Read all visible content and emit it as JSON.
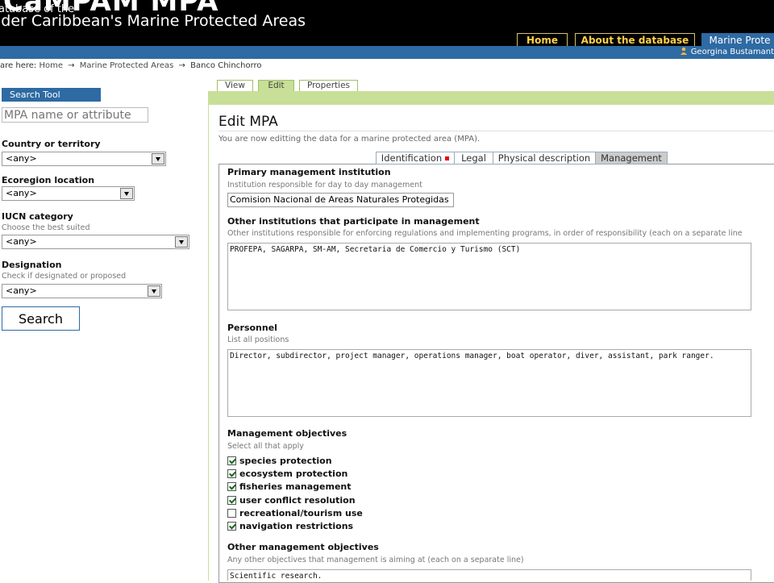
{
  "header": {
    "logo_text": "CaMPAM MPA",
    "subtitle1": "atabase of the",
    "subtitle2": "ider Caribbean's Marine Protected Areas",
    "nav": [
      {
        "label": "Home"
      },
      {
        "label": "About the database"
      },
      {
        "label": "Marine Prote"
      }
    ],
    "user_name": "Georgina Bustamant"
  },
  "breadcrumb": {
    "prefix": "are here:",
    "items": [
      "Home",
      "Marine Protected Areas",
      "Banco Chinchorro"
    ],
    "arrow": "→"
  },
  "sidebar": {
    "title": "Search Tool",
    "search_placeholder": "MPA name or attribute",
    "filters": [
      {
        "label": "Country or territory",
        "sub": "",
        "value": "<any>"
      },
      {
        "label": "Ecoregion location",
        "sub": "",
        "value": "<any>"
      },
      {
        "label": "IUCN category",
        "sub": "Choose the best suited",
        "value": "<any>"
      },
      {
        "label": "Designation",
        "sub": "Check if designated or proposed",
        "value": "<any>"
      }
    ],
    "search_button": "Search"
  },
  "edit_tabs": [
    {
      "label": "View",
      "active": false
    },
    {
      "label": "Edit",
      "active": true
    },
    {
      "label": "Properties",
      "active": false
    }
  ],
  "main": {
    "title": "Edit MPA",
    "intro": "You are now editting the data for a marine protected area (MPA).",
    "section_tabs": [
      {
        "label": "Identification",
        "required": true,
        "active": false
      },
      {
        "label": "Legal",
        "required": false,
        "active": false
      },
      {
        "label": "Physical description",
        "required": false,
        "active": false
      },
      {
        "label": "Management",
        "required": false,
        "active": true
      }
    ],
    "fields": {
      "primary_institution": {
        "label": "Primary management institution",
        "help": "Institution responsible for day to day management",
        "value": "Comision Nacional de Areas Naturales Protegidas"
      },
      "other_institutions": {
        "label": "Other institutions that participate in management",
        "help": "Other institutions responsible for enforcing regulations and implementing programs, in order of responsibility (each on a separate line",
        "value": "PROFEPA, SAGARPA, SM-AM, Secretaria de Comercio y Turismo (SCT)"
      },
      "personnel": {
        "label": "Personnel",
        "help": "List all positions",
        "value": "Director, subdirector, project manager, operations manager, boat operator, diver, assistant, park ranger."
      },
      "objectives": {
        "label": "Management objectives",
        "help": "Select all that apply",
        "options": [
          {
            "label": "species protection",
            "checked": true
          },
          {
            "label": "ecosystem protection",
            "checked": true
          },
          {
            "label": "fisheries management",
            "checked": true
          },
          {
            "label": "user conflict resolution",
            "checked": true
          },
          {
            "label": "recreational/tourism use",
            "checked": false
          },
          {
            "label": "navigation restrictions",
            "checked": true
          }
        ]
      },
      "other_objectives": {
        "label": "Other management objectives",
        "help": "Any other objectives that management is aiming at (each on a separate line)",
        "value": "Scientific research."
      }
    }
  },
  "colors": {
    "black_header": "#000000",
    "blue_bar": "#2e6aa3",
    "nav_text": "#ffd24a",
    "green_bar": "#c8df98"
  }
}
